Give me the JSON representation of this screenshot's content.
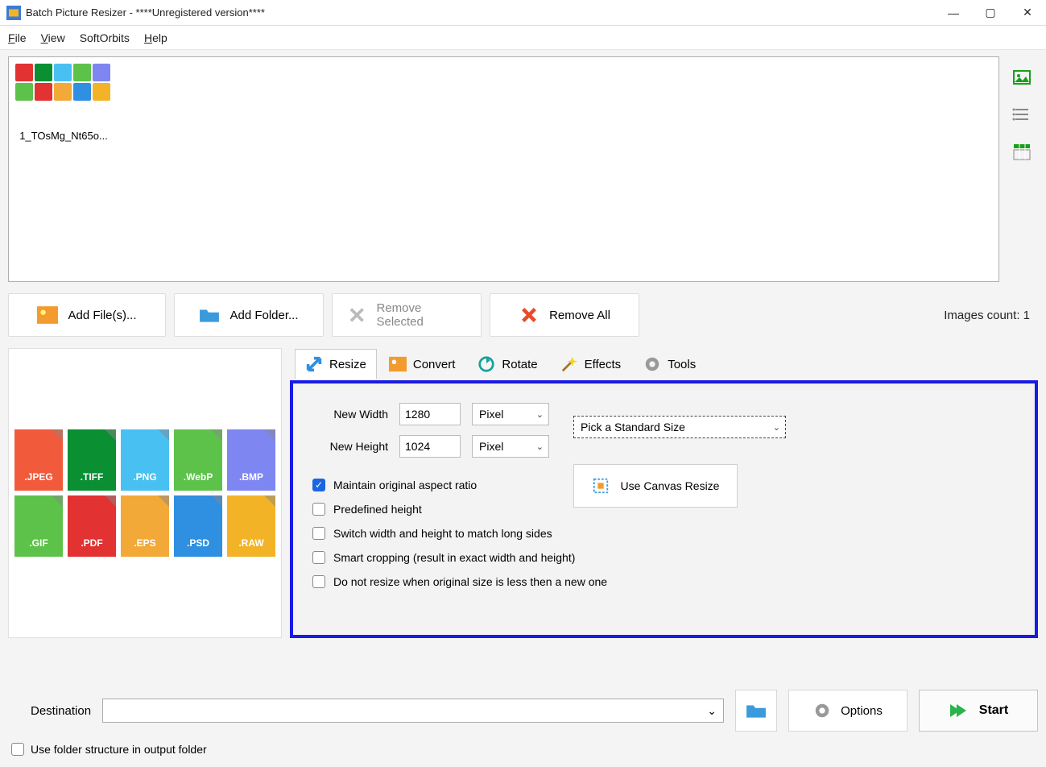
{
  "titlebar": {
    "title": "Batch Picture Resizer - ****Unregistered version****"
  },
  "menu": {
    "file": "File",
    "view": "View",
    "softorbits": "SoftOrbits",
    "help": "Help"
  },
  "preview": {
    "item_name": "1_TOsMg_Nt65o..."
  },
  "toolbar": {
    "add_file": "Add File(s)...",
    "add_folder": "Add Folder...",
    "remove_selected": "Remove Selected",
    "remove_all": "Remove All",
    "images_count": "Images count: 1"
  },
  "formats": [
    "JPEG",
    "TIFF",
    "PNG",
    "WebP",
    "BMP",
    "GIF",
    "PDF",
    "EPS",
    "PSD",
    "RAW"
  ],
  "format_colors": [
    "#f15a3b",
    "#0a8f33",
    "#49c0f2",
    "#5dc24a",
    "#7e86f2",
    "#5dc24a",
    "#e23232",
    "#f2a938",
    "#2f8fe0",
    "#f2b426"
  ],
  "tabs": {
    "resize": "Resize",
    "convert": "Convert",
    "rotate": "Rotate",
    "effects": "Effects",
    "tools": "Tools"
  },
  "resize": {
    "new_width_label": "New Width",
    "new_height_label": "New Height",
    "width_value": "1280",
    "height_value": "1024",
    "unit": "Pixel",
    "standard": "Pick a Standard Size",
    "maintain": "Maintain original aspect ratio",
    "predefined": "Predefined height",
    "switch": "Switch width and height to match long sides",
    "smart": "Smart cropping (result in exact width and height)",
    "noresize": "Do not resize when original size is less then a new one",
    "canvas": "Use Canvas Resize"
  },
  "footer": {
    "destination": "Destination",
    "options": "Options",
    "start": "Start",
    "folder_structure": "Use folder structure in output folder"
  }
}
